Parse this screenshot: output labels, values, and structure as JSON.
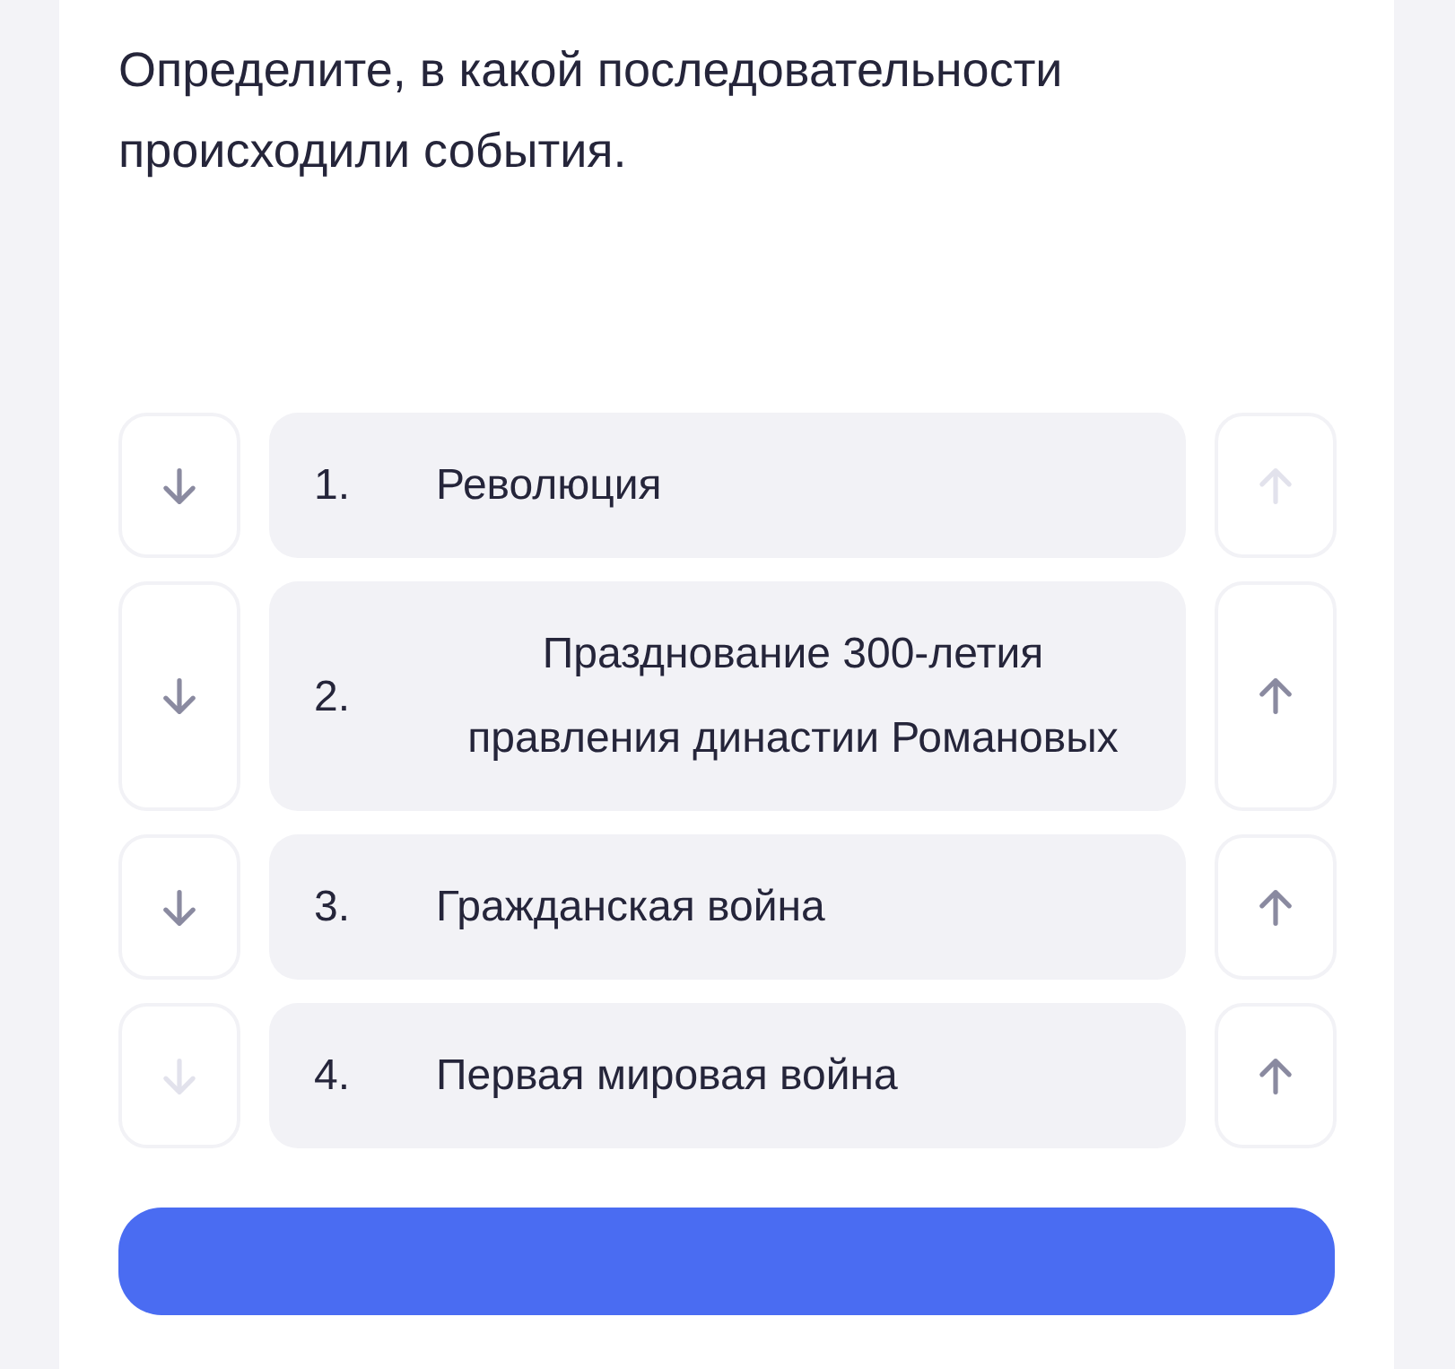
{
  "question": "Определите, в какой последовательности происходили события.",
  "items": [
    {
      "number": "1.",
      "text": "Революция",
      "down_disabled": false,
      "up_disabled": true
    },
    {
      "number": "2.",
      "text": "Празднование 300-летия правления династии Романовых",
      "down_disabled": false,
      "up_disabled": false
    },
    {
      "number": "3.",
      "text": "Гражданская война",
      "down_disabled": false,
      "up_disabled": false
    },
    {
      "number": "4.",
      "text": "Первая мировая война",
      "down_disabled": true,
      "up_disabled": false
    }
  ]
}
